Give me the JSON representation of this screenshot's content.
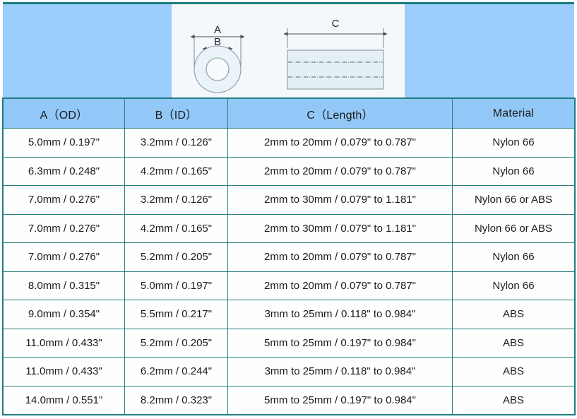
{
  "diagram": {
    "panel_name": "tube-dimension-drawing",
    "cross_section": {
      "name": "tube-cross-section",
      "label_outer": "A",
      "label_inner": "B"
    },
    "side_view": {
      "name": "tube-side-view",
      "label_length": "C"
    },
    "colors": {
      "banner_blue": "#9bcdfd",
      "panel_white": "#f4f8fb",
      "drawing_line": "#6b7f8c",
      "drawing_fill": "#e7f1f7",
      "dim_line": "#55626b"
    }
  },
  "table": {
    "headers": [
      "A（OD）",
      "B（ID）",
      "C（Length）",
      "Material"
    ],
    "rows": [
      {
        "od": "5.0mm / 0.197\"",
        "id": "3.2mm / 0.126\"",
        "length": "2mm to 20mm / 0.079\" to 0.787\"",
        "material": "Nylon 66"
      },
      {
        "od": "6.3mm / 0.248\"",
        "id": "4.2mm / 0.165\"",
        "length": "2mm to 20mm / 0.079\" to 0.787\"",
        "material": "Nylon 66"
      },
      {
        "od": "7.0mm / 0.276\"",
        "id": "3.2mm / 0.126\"",
        "length": "2mm to 30mm / 0.079\" to 1.181\"",
        "material": "Nylon 66 or ABS"
      },
      {
        "od": "7.0mm / 0.276\"",
        "id": "4.2mm / 0.165\"",
        "length": "2mm to 30mm / 0.079\" to 1.181\"",
        "material": "Nylon 66 or ABS"
      },
      {
        "od": "7.0mm / 0.276\"",
        "id": "5.2mm / 0.205\"",
        "length": "2mm to 20mm / 0.079\" to 0.787\"",
        "material": "Nylon 66"
      },
      {
        "od": "8.0mm / 0.315\"",
        "id": "5.0mm / 0.197\"",
        "length": "2mm to 20mm / 0.079\" to 0.787\"",
        "material": "Nylon 66"
      },
      {
        "od": "9.0mm / 0.354\"",
        "id": "5.5mm / 0.217\"",
        "length": "3mm to 25mm / 0.118\" to 0.984\"",
        "material": "ABS"
      },
      {
        "od": "11.0mm / 0.433\"",
        "id": "5.2mm / 0.205\"",
        "length": "5mm to 25mm / 0.197\" to 0.984\"",
        "material": "ABS"
      },
      {
        "od": "11.0mm / 0.433\"",
        "id": "6.2mm / 0.244\"",
        "length": "3mm to 25mm / 0.118\" to 0.984\"",
        "material": "ABS"
      },
      {
        "od": "14.0mm / 0.551\"",
        "id": "8.2mm / 0.323\"",
        "length": "5mm to 25mm / 0.197\" to 0.984\"",
        "material": "ABS"
      }
    ],
    "colors": {
      "header_bg": "#92c8f8",
      "border": "#2b7f7f",
      "cell_bg": "#fdfefe",
      "text": "#1b1b1b"
    }
  }
}
